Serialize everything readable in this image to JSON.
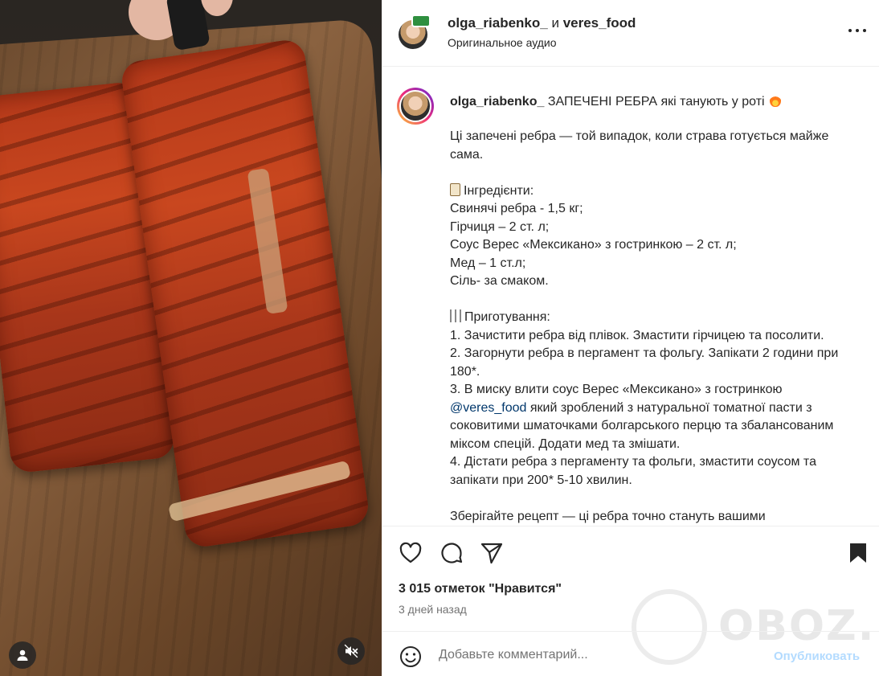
{
  "header": {
    "user1": "olga_riabenko_",
    "conjunction": "и",
    "user2": "veres_food",
    "audio": "Оригинальное аудио"
  },
  "caption": {
    "author": "olga_riabenko_",
    "title": "ЗАПЕЧЕНІ РЕБРА які танують у роті",
    "intro": "Ці запечені ребра — той випадок, коли страва готується майже сама.",
    "ingredients_heading": "Інгредієнти:",
    "ingredients": [
      "Свинячі ребра - 1,5 кг;",
      "Гірчиця – 2 ст. л;",
      "Соус Верес «Мексикано» з гостринкою – 2 ст. л;",
      "Мед – 1 ст.л;",
      "Сіль- за смаком."
    ],
    "steps_heading": "Приготування:",
    "step1": "1. Зачистити ребра від плівок. Змастити гірчицею та посолити.",
    "step2": "2. Загорнути ребра в пергамент та фольгу. Запікати 2 години при 180*.",
    "step3_a": "3. В миску влити соус Верес «Мексикано» з гостринкою ",
    "step3_mention": "@veres_food",
    "step3_b": " який зроблений з натуральної томатної пасти з соковитими шматочками болгарського перцю та збалансованим міксом спецій. Додати мед та змішати.",
    "step4": "4. Дістати ребра з пергаменту та фольги, змастити соусом та запікати при 200* 5-10 хвилин.",
    "outro": "Зберігайте рецепт — ці ребра точно стануть вашими"
  },
  "stats": {
    "likes": "3 015 отметок \"Нравится\"",
    "time_ago": "3 дней назад"
  },
  "comment": {
    "placeholder": "Добавьте комментарий...",
    "publish_label": "Опубликовать"
  },
  "watermark": {
    "text": "OBOZ.UA"
  },
  "icons": {
    "like": "heart-icon",
    "comment": "comment-icon",
    "share": "send-icon",
    "save": "bookmark-icon",
    "more": "more-icon",
    "emoji": "emoji-icon",
    "mute": "mute-icon",
    "user": "user-icon"
  },
  "colors": {
    "link": "#00376b",
    "publish_disabled": "#b3dbff",
    "muted_text": "#737373"
  }
}
